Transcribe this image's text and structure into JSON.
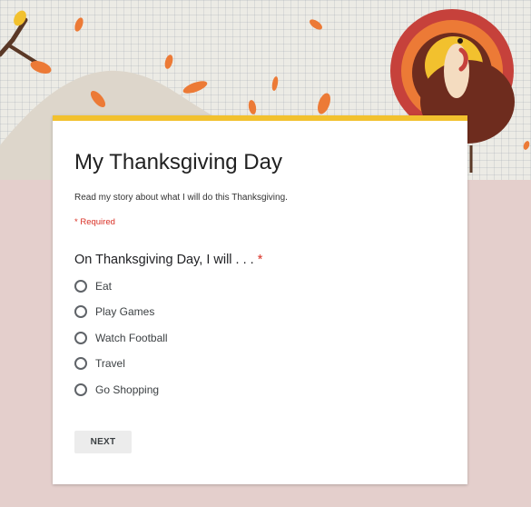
{
  "form": {
    "title": "My Thanksgiving Day",
    "description": "Read my story about what I will do this Thanksgiving.",
    "required_note": "* Required",
    "question": {
      "text": "On Thanksgiving Day, I will . . .",
      "required_mark": "*",
      "options": [
        {
          "label": "Eat"
        },
        {
          "label": "Play Games"
        },
        {
          "label": "Watch Football"
        },
        {
          "label": "Travel"
        },
        {
          "label": "Go Shopping"
        }
      ]
    },
    "next_label": "NEXT"
  },
  "theme": {
    "accent_color": "#f2c12e",
    "page_background": "#e4cfcc",
    "required_color": "#d93025",
    "leaf_color": "#ec7a36"
  },
  "header_art": {
    "icons": [
      "turkey-icon",
      "autumn-leaf-icon",
      "tree-branch-icon"
    ]
  }
}
